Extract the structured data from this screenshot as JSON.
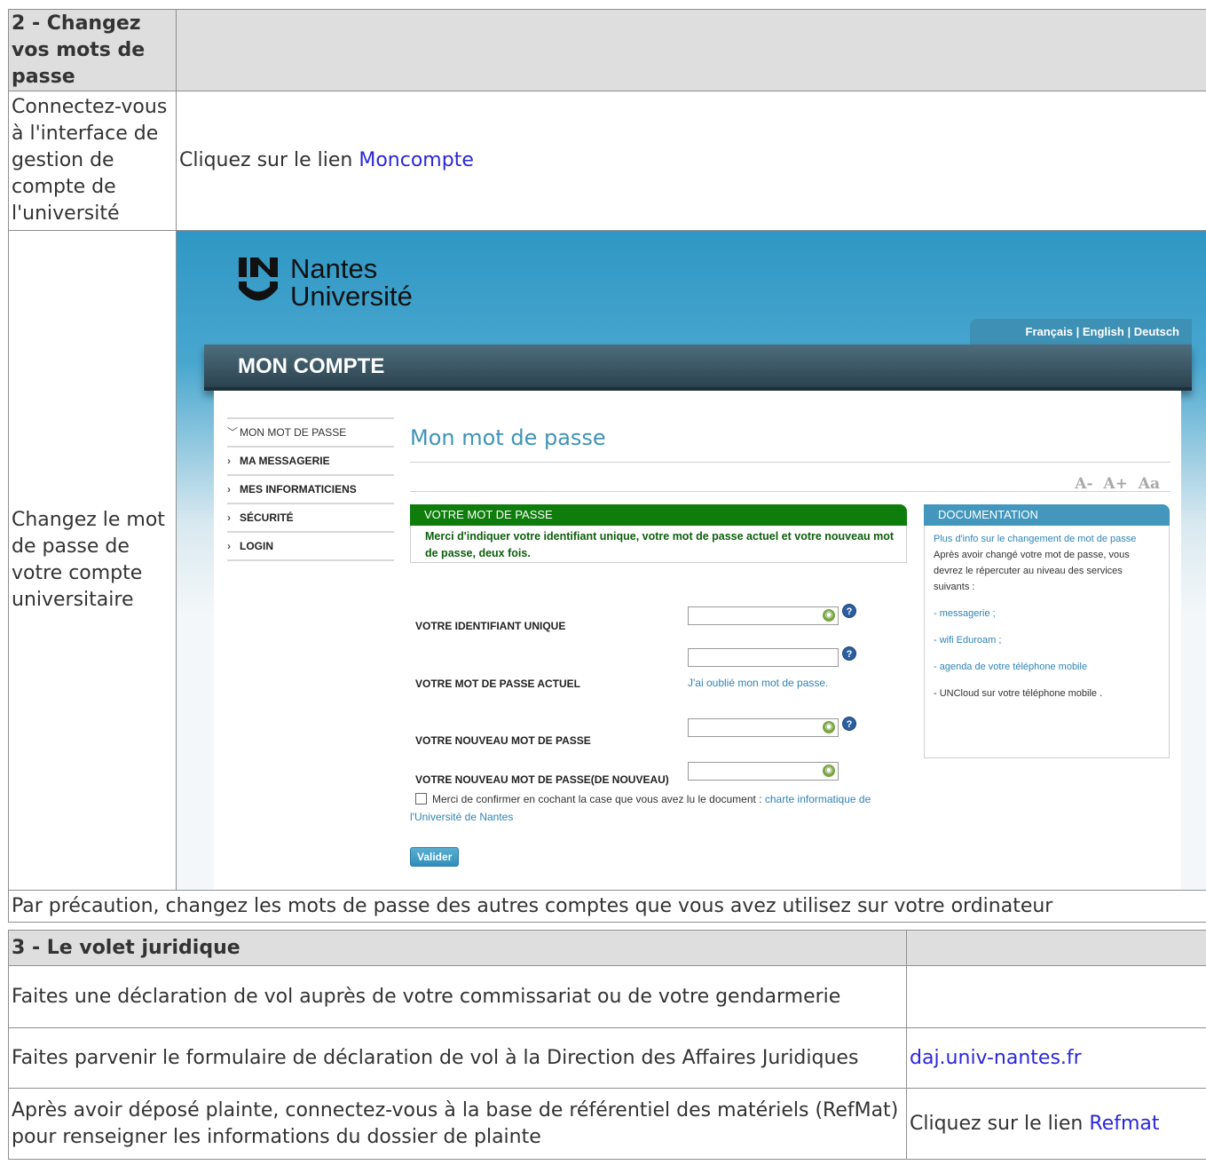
{
  "section2": {
    "title": "2 - Changez vos mots de passe",
    "row1_label": "Connectez-vous à l'interface de gestion de compte de l'université",
    "row1_text": "Cliquez sur le lien ",
    "row1_link": "Moncompte",
    "row2_label": "Changez le mot de passe de votre compte universitaire",
    "precaution": "Par précaution, changez les mots de passe des autres comptes que vous avez utilisez sur votre ordinateur"
  },
  "screenshot": {
    "logo_line1": "Nantes",
    "logo_line2": "Université",
    "languages": [
      "Français",
      "English",
      "Deutsch"
    ],
    "banner_title": "MON COMPTE",
    "nav": [
      "MON MOT DE PASSE",
      "MA MESSAGERIE",
      "MES INFORMATICIENS",
      "SÉCURITÉ",
      "LOGIN"
    ],
    "page_title": "Mon mot de passe",
    "font_controls": [
      "A-",
      "A+",
      "Aa"
    ],
    "password_box_title": "VOTRE MOT DE PASSE",
    "password_box_text": "Merci d'indiquer votre identifiant unique, votre mot de passe actuel et votre nouveau mot de passe, deux fois.",
    "doc_title": "DOCUMENTATION",
    "doc_link": "Plus d'info sur le changement de mot de passe",
    "doc_text": "Après avoir changé votre mot de passe, vous devrez le répercuter au niveau des services suivants :",
    "doc_items": [
      "- messagerie ;",
      "- wifi Eduroam ;",
      "- agenda de votre téléphone mobile",
      "- UNCloud sur votre téléphone mobile ."
    ],
    "label_id": "VOTRE IDENTIFIANT UNIQUE",
    "label_current": "VOTRE MOT DE PASSE ACTUEL",
    "label_new": "VOTRE NOUVEAU MOT DE PASSE",
    "label_new_again": "VOTRE NOUVEAU MOT DE PASSE(DE NOUVEAU)",
    "forgot_link": "J'ai oublié mon mot de passe.",
    "confirm_text": "Merci de confirmer en cochant la case que vous avez lu le document : ",
    "confirm_link": "charte informatique de l'Université de Nantes",
    "submit_label": "Valider"
  },
  "section3": {
    "title": "3 - Le volet juridique",
    "row1_text": "Faites une déclaration de vol auprès de votre commissariat ou de votre gendarmerie",
    "row2_text": "Faites parvenir le formulaire de déclaration de vol à la Direction des Affaires Juridiques",
    "row2_link": "daj.univ-nantes.fr",
    "row3_text": "Après avoir déposé plainte, connectez-vous à la base de référentiel des matériels (RefMat) pour renseigner les informations du dossier de plainte",
    "row3_prefix": "Cliquez sur le lien ",
    "row3_link": "Refmat"
  }
}
